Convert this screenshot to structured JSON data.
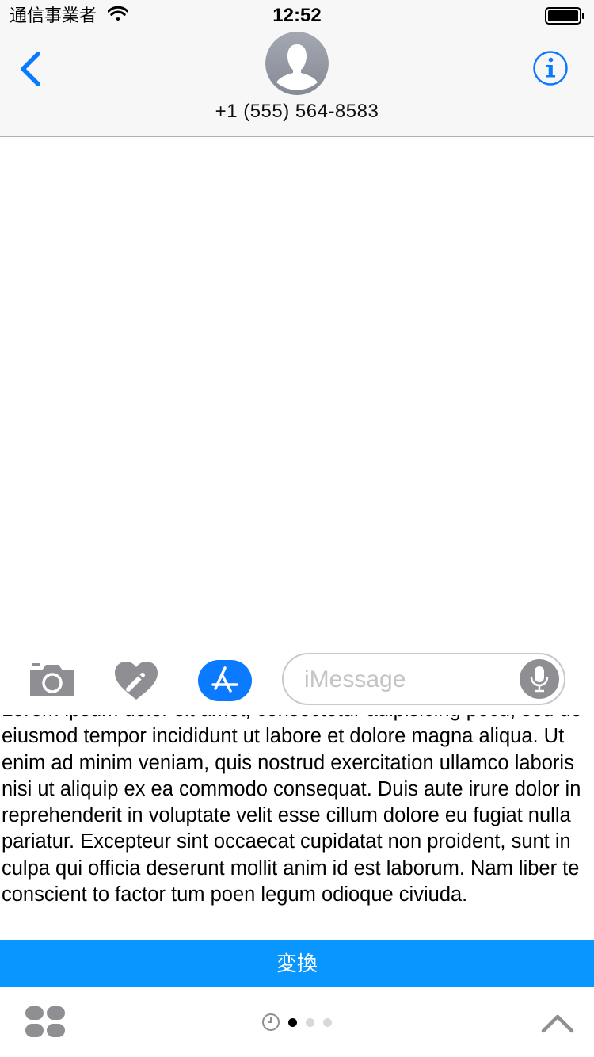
{
  "status_bar": {
    "carrier": "通信事業者",
    "time": "12:52"
  },
  "header": {
    "contact_name": "+1 (555) 564-8583"
  },
  "input_bar": {
    "placeholder": "iMessage"
  },
  "candidate": {
    "text": "Lorem ipsum dolor sit amet, consectetur adipisicing pecu, sed do eiusmod tempor incididunt ut labore et dolore magna aliqua. Ut enim ad minim veniam, quis nostrud exercitation ullamco laboris nisi ut aliquip ex ea commodo consequat. Duis aute irure dolor in reprehenderit in voluptate velit esse cillum dolore eu fugiat nulla pariatur. Excepteur sint occaecat cupidatat non proident, sunt in culpa qui officia deserunt mollit anim id est laborum. Nam liber te conscient to factor tum poen legum odioque civiuda."
  },
  "convert_bar": {
    "label": "変換"
  },
  "colors": {
    "accent": "#0a7aff",
    "convert_bar": "#0a96ff",
    "icon_gray": "#8e8e93",
    "placeholder": "#c4c4c7"
  },
  "icons": {
    "back": "chevron-left-icon",
    "info": "info-icon",
    "camera": "camera-icon",
    "digital_touch": "heart-icon",
    "app_store": "app-store-icon",
    "mic": "microphone-icon",
    "apps_drawer": "apps-drawer-icon",
    "recents": "clock-icon",
    "expand": "chevron-up-icon"
  },
  "page_indicator": {
    "pages": 3,
    "current": 1
  }
}
